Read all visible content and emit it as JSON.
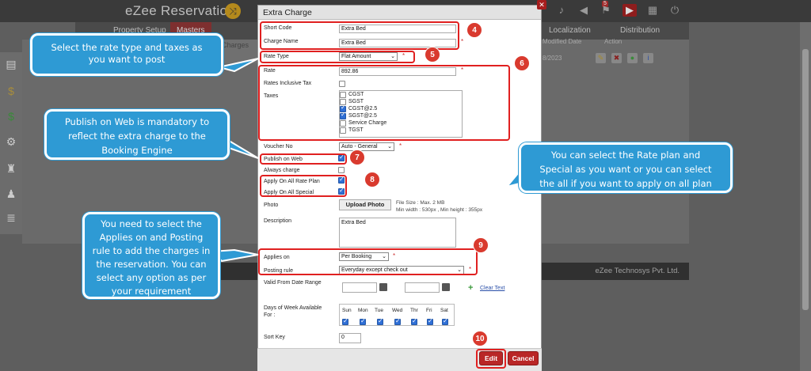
{
  "app": {
    "title": "eZee Reservation",
    "footer_company": "eZee Technosys Pvt. Ltd."
  },
  "topnav": {
    "tabs": [
      "Property Setup",
      "Masters",
      "Localization",
      "Distribution"
    ],
    "badge_count": "5"
  },
  "background_table": {
    "col_left": "Charges",
    "col_modified": "Modified Date",
    "col_action": "Action",
    "row_date": "8/2023"
  },
  "modal": {
    "title": "Extra Charge",
    "short_code_label": "Short Code",
    "short_code_value": "Extra Bed",
    "charge_name_label": "Charge Name",
    "charge_name_value": "Extra Bed",
    "rate_type_label": "Rate Type",
    "rate_type_value": "Flat Amount",
    "rate_label": "Rate",
    "rate_value": "892.86",
    "rates_inclusive_tax_label": "Rates Inclusive Tax",
    "taxes_label": "Taxes",
    "taxes": [
      {
        "name": "CGST",
        "checked": false
      },
      {
        "name": "SGST",
        "checked": false
      },
      {
        "name": "CGST@2.5",
        "checked": true
      },
      {
        "name": "SGST@2.5",
        "checked": true
      },
      {
        "name": "Service Charge",
        "checked": false
      },
      {
        "name": "TGST",
        "checked": false
      }
    ],
    "voucher_no_label": "Voucher No",
    "voucher_no_value": "Auto - General",
    "publish_on_web_label": "Publish on Web",
    "always_charge_label": "Always charge",
    "apply_all_rate_plan_label": "Apply On All Rate Plan",
    "apply_all_special_label": "Apply On All Special",
    "photo_label": "Photo",
    "upload_photo": "Upload Photo",
    "file_size_note": "File Size : Max. 2 MB",
    "file_dims_note": "Min width : 530px , Min height : 355px",
    "description_label": "Description",
    "description_value": "Extra Bed",
    "applies_on_label": "Applies on",
    "applies_on_value": "Per Booking",
    "posting_rule_label": "Posting rule",
    "posting_rule_value": "Everyday except check out",
    "valid_from_label": "Valid From Date Range",
    "clear_text": "Clear Text",
    "days_label_1": "Days of Week Available",
    "days_label_2": "For :",
    "days": [
      "Sun",
      "Mon",
      "Tue",
      "Wed",
      "Thr",
      "Fri",
      "Sat"
    ],
    "sort_key_label": "Sort Key",
    "sort_key_value": "0",
    "edit_button": "Edit",
    "cancel_button": "Cancel"
  },
  "annotations": {
    "bubble_rate": [
      "Select the rate type and taxes as",
      "you want to post"
    ],
    "bubble_publish": [
      "Publish on Web is mandatory to",
      "reflect the extra charge to the",
      "Booking Engine"
    ],
    "bubble_rateplan": [
      "You can select the Rate plan and",
      "Special as you want or you can select",
      "the all if you want to apply on all plan"
    ],
    "bubble_applies": [
      "You need to select the",
      "Applies on and Posting",
      "rule to add the charges in",
      "the reservation. You can",
      "select any option as per",
      "your requirement"
    ],
    "step_numbers": [
      "4",
      "5",
      "6",
      "7",
      "8",
      "9",
      "10"
    ]
  },
  "colors": {
    "annotation_red": "#e02020",
    "bubble_blue": "#2e9ad4",
    "button_red": "#b92727"
  }
}
